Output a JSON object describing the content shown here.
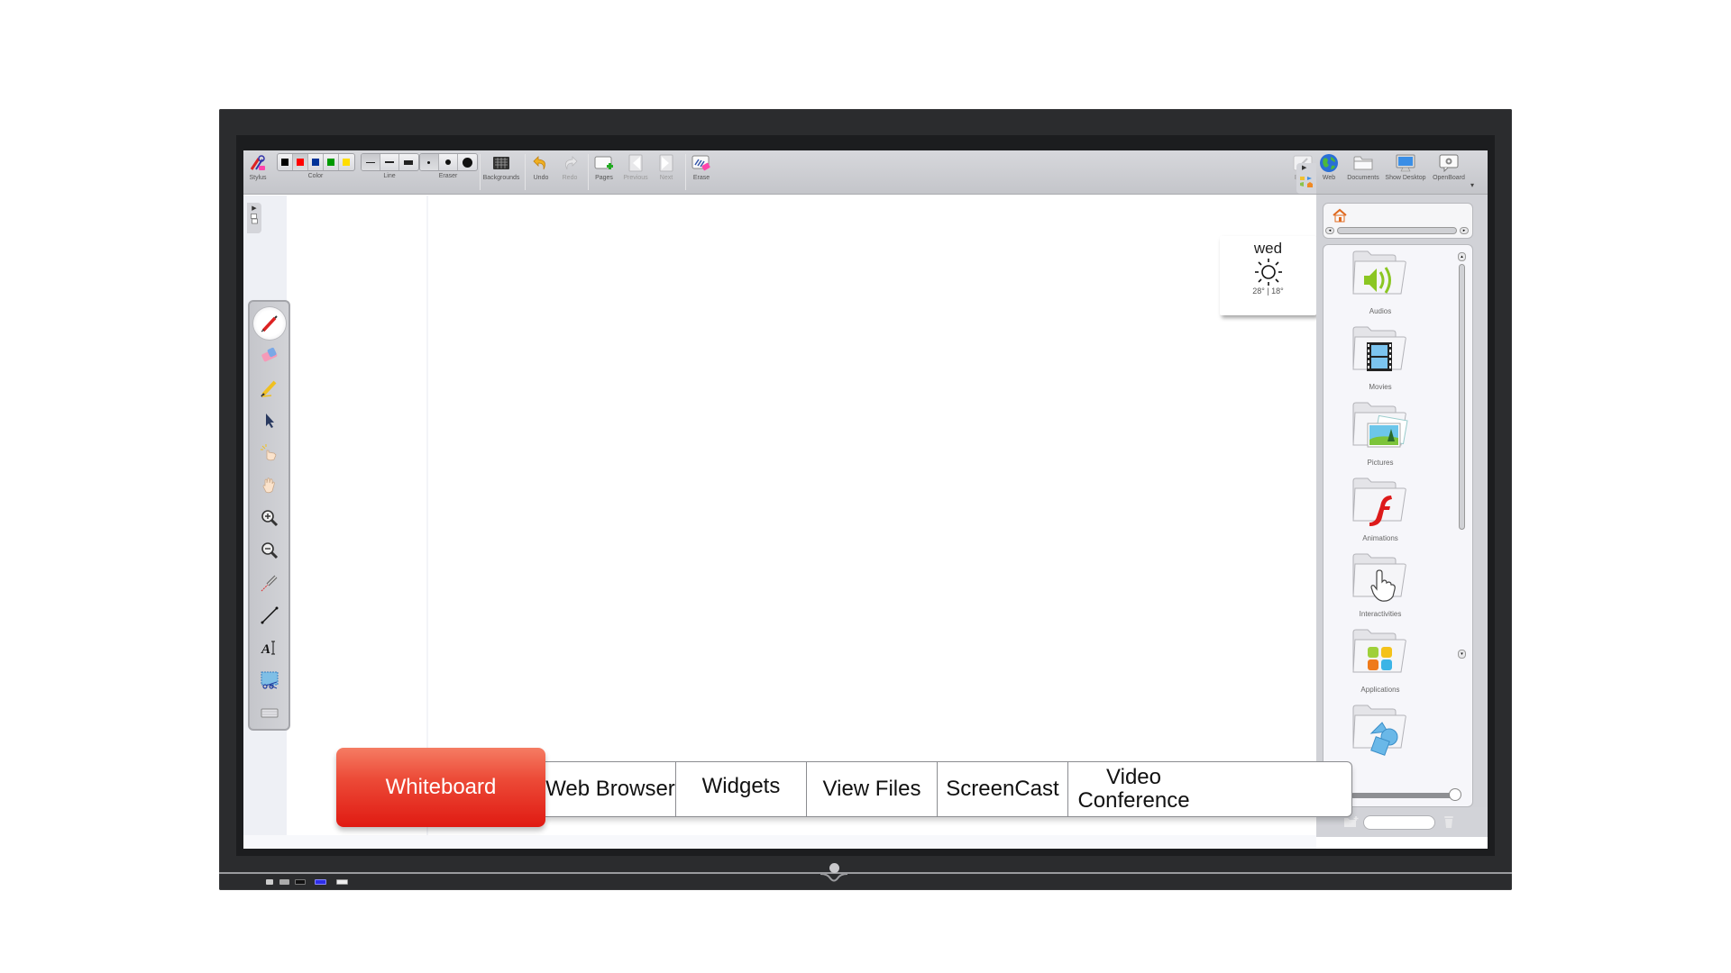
{
  "toolbar": {
    "stylus": {
      "label": "Stylus",
      "icon": "stylus-icon"
    },
    "color": {
      "label": "Color",
      "swatches": [
        "#000000",
        "#ff0000",
        "#003399",
        "#009900",
        "#ffdd00"
      ],
      "selected_index": 1
    },
    "line": {
      "label": "Line",
      "options": [
        "thin",
        "medium",
        "thick"
      ],
      "selected_index": 0
    },
    "eraser": {
      "label": "Eraser",
      "options": [
        "small",
        "medium",
        "large"
      ],
      "selected_index": 0
    },
    "backgrounds": {
      "label": "Backgrounds",
      "icon": "backgrounds-icon"
    },
    "undo": {
      "label": "Undo",
      "icon": "undo-icon",
      "enabled": true
    },
    "redo": {
      "label": "Redo",
      "icon": "redo-icon",
      "enabled": false
    },
    "pages": {
      "label": "Pages",
      "icon": "add-page-icon"
    },
    "previous": {
      "label": "Previous",
      "icon": "previous-page-icon",
      "enabled": false
    },
    "next": {
      "label": "Next",
      "icon": "next-page-icon",
      "enabled": false
    },
    "erase": {
      "label": "Erase",
      "icon": "erase-icon"
    },
    "board": {
      "label": "Board",
      "icon": "board-icon",
      "enabled": false
    },
    "web": {
      "label": "Web",
      "icon": "globe-icon"
    },
    "documents": {
      "label": "Documents",
      "icon": "folder-icon"
    },
    "show_desktop": {
      "label": "Show Desktop",
      "icon": "monitor-icon"
    },
    "openboard": {
      "label": "OpenBoard",
      "icon": "openboard-gear-icon"
    }
  },
  "tools": [
    {
      "name": "pen",
      "icon": "pen-tool-icon",
      "active": true
    },
    {
      "name": "eraser",
      "icon": "eraser-tool-icon"
    },
    {
      "name": "marker",
      "icon": "marker-tool-icon"
    },
    {
      "name": "selector",
      "icon": "arrow-pointer-icon"
    },
    {
      "name": "play",
      "icon": "pointing-hand-icon"
    },
    {
      "name": "hand",
      "icon": "hand-icon"
    },
    {
      "name": "zoom-in",
      "icon": "zoom-in-icon"
    },
    {
      "name": "zoom-out",
      "icon": "zoom-out-icon"
    },
    {
      "name": "laser",
      "icon": "laser-pointer-icon"
    },
    {
      "name": "line",
      "icon": "line-tool-icon"
    },
    {
      "name": "text",
      "icon": "text-tool-icon"
    },
    {
      "name": "capture",
      "icon": "capture-tool-icon"
    },
    {
      "name": "keyboard",
      "icon": "keyboard-icon"
    }
  ],
  "weather": {
    "day": "wed",
    "temp": "28° | 18°",
    "icon": "sun-icon"
  },
  "library": {
    "items": [
      {
        "label": "Audios",
        "icon": "audio-folder-icon"
      },
      {
        "label": "Movies",
        "icon": "movies-folder-icon"
      },
      {
        "label": "Pictures",
        "icon": "pictures-folder-icon"
      },
      {
        "label": "Animations",
        "icon": "animations-folder-icon"
      },
      {
        "label": "Interactivities",
        "icon": "interactivities-folder-icon"
      },
      {
        "label": "Applications",
        "icon": "applications-folder-icon"
      },
      {
        "label": "",
        "icon": "shapes-folder-icon"
      }
    ],
    "search_value": ""
  },
  "app_tabs": [
    {
      "label": "Whiteboard",
      "active": true
    },
    {
      "label": "Web Browser"
    },
    {
      "label": "Widgets"
    },
    {
      "label": "View Files"
    },
    {
      "label": "ScreenCast"
    },
    {
      "label": "Video Conference"
    }
  ],
  "colors": {
    "accent_red": "#e5261a",
    "bezel": "#2b2c2e",
    "toolbar_bg": "#cfd0d4"
  }
}
